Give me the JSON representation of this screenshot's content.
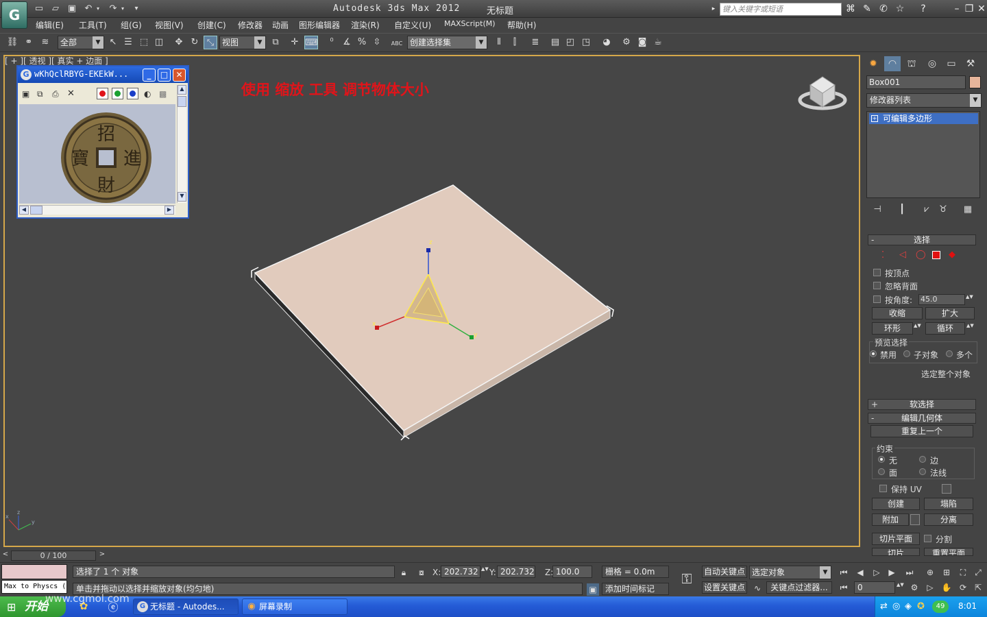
{
  "app": {
    "title": "Autodesk 3ds Max  2012",
    "document": "无标题",
    "logo": "G",
    "search_placeholder": "键入关键字或短语"
  },
  "menus": [
    "编辑(E)",
    "工具(T)",
    "组(G)",
    "视图(V)",
    "创建(C)",
    "修改器",
    "动画",
    "图形编辑器",
    "渲染(R)",
    "自定义(U)",
    "MAXScript(M)",
    "帮助(H)"
  ],
  "toolbar": {
    "selection_filter": "全部",
    "ref_coord": "视图",
    "named_selection": "创建选择集",
    "abc_label": "ABC"
  },
  "viewport": {
    "label": "[ + ][ 透视 ][ 真实 + 边面 ]",
    "caption": "使用 缩放 工具 调节物体大小",
    "gizmo_x": "x",
    "gizmo_y": "y",
    "gizmo_z": "z",
    "axis_x": "x",
    "axis_y": "y",
    "axis_z": "z"
  },
  "image_viewer": {
    "title": "wKhQclRBYG-EKEkW...",
    "colors": [
      "#e0141a",
      "#1aa030",
      "#1a3ec8"
    ],
    "coin_chars": [
      "招",
      "進",
      "財",
      "寶"
    ]
  },
  "command_panel": {
    "object_name": "Box001",
    "object_color": "#e7b59b",
    "modifier_list": "修改器列表",
    "stack_item": "可编辑多边形",
    "selection": {
      "title": "选择",
      "by_vertex": "按顶点",
      "ignore_backfacing": "忽略背面",
      "by_angle": "按角度:",
      "angle_value": "45.0",
      "shrink": "收缩",
      "grow": "扩大",
      "ring": "环形",
      "loop": "循环",
      "preview_title": "预览选择",
      "preview_off": "禁用",
      "preview_sub": "子对象",
      "preview_multi": "多个",
      "whole_object": "选定整个对象"
    },
    "soft_selection": "软选择",
    "edit_geometry": {
      "title": "编辑几何体",
      "repeat_last": "重复上一个",
      "constraints": "约束",
      "c_none": "无",
      "c_edge": "边",
      "c_face": "面",
      "c_normal": "法线",
      "preserve_uv": "保持 UV",
      "create": "创建",
      "collapse": "塌陷",
      "attach": "附加",
      "detach": "分离",
      "slice_plane": "切片平面",
      "split": "分割",
      "slice": "切片",
      "reset_plane": "重置平面"
    }
  },
  "timeline": {
    "frame": "0 / 100"
  },
  "status": {
    "maxscript": "Max to Physcs (",
    "selected": "选择了 1 个 对象",
    "prompt": "单击并拖动以选择并缩放对象(均匀地)",
    "x_label": "X:",
    "x_value": "202.732",
    "y_label": "Y:",
    "y_value": "202.732",
    "z_label": "Z:",
    "z_value": "100.0",
    "grid": "栅格 = 0.0m",
    "add_time_tag": "添加时间标记",
    "auto_key": "自动关键点",
    "set_key": "设置关键点",
    "key_target": "选定对象",
    "key_filters": "关键点过滤器...",
    "current_frame": "0"
  },
  "taskbar": {
    "start": "开始",
    "tasks": [
      "无标题 - Autodes...",
      "屏幕录制"
    ],
    "clock": "8:01",
    "tray_badge": "49",
    "watermark": "www.cgmol.com"
  }
}
